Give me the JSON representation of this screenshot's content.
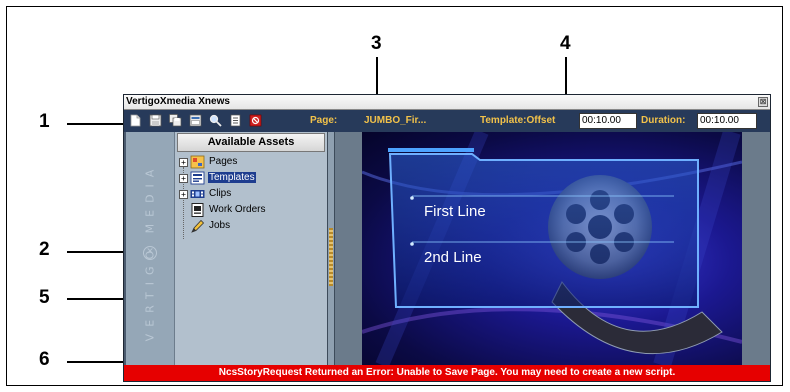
{
  "window": {
    "title": "VertigoXmedia Xnews",
    "close_glyph": "⊠"
  },
  "toolbar": {
    "icons": [
      "new-page-icon",
      "save-icon",
      "save-all-icon",
      "open-icon",
      "search-icon",
      "properties-icon",
      "delete-icon"
    ],
    "page_label": "Page:",
    "page_value": "JUMBO_Fir...",
    "template_label": "Template:Offset",
    "template_time": "00:10.00",
    "duration_label": "Duration:",
    "duration_value": "00:10.00",
    "label_color": "#f2c24a"
  },
  "sidebar": {
    "brand": "VERTIGO MEDIA",
    "brand_mark": "✕"
  },
  "assets": {
    "header": "Available Assets",
    "items": [
      {
        "label": "Pages",
        "icon": "pages-icon",
        "expandable": true,
        "selected": false
      },
      {
        "label": "Templates",
        "icon": "templates-icon",
        "expandable": true,
        "selected": true
      },
      {
        "label": "Clips",
        "icon": "clips-icon",
        "expandable": true,
        "selected": false
      },
      {
        "label": "Work Orders",
        "icon": "work-orders-icon",
        "expandable": false,
        "selected": false
      },
      {
        "label": "Jobs",
        "icon": "jobs-icon",
        "expandable": false,
        "selected": false
      }
    ],
    "expander_glyph": "+"
  },
  "preview": {
    "line1": "First Line",
    "line2": "2nd Line"
  },
  "status": {
    "message": "NcsStoryRequest Returned an Error: Unable to Save Page. You may need to create a new script.",
    "color": "#e60000"
  },
  "callouts": [
    "1",
    "2",
    "3",
    "4",
    "5",
    "6"
  ]
}
